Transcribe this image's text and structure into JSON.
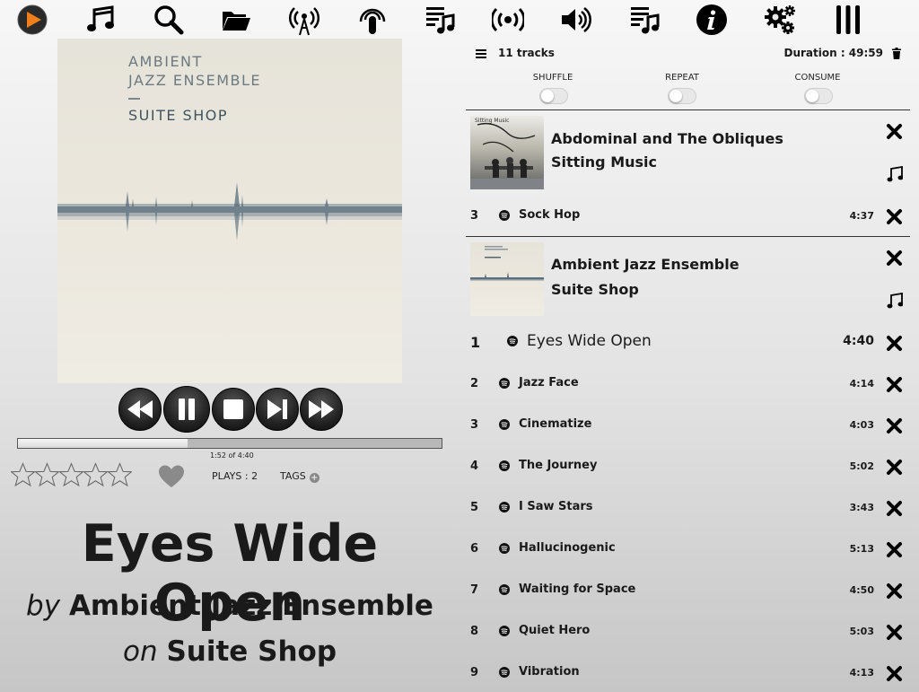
{
  "toolbar": {
    "icons": [
      "play-logo-icon",
      "music-library-icon",
      "search-icon",
      "folder-icon",
      "radio-tower-icon",
      "podcast-icon",
      "queue-music-icon",
      "stream-icon",
      "volume-icon",
      "playlist-icon",
      "info-icon",
      "settings-icon",
      "columns-icon"
    ]
  },
  "now_playing": {
    "cover": {
      "artist_text": "AMBIENT\nJAZZ ENSEMBLE",
      "album_text": "SUITE SHOP"
    },
    "progress": 0.4,
    "time_text": "1:52 of 4:40",
    "rating_stars": 0,
    "plays_text": "PLAYS : 2",
    "tags_label": "TAGS",
    "title": "Eyes Wide Open",
    "by_word": "by",
    "artist": "Ambient Jazz Ensemble",
    "on_word": "on",
    "album": "Suite Shop"
  },
  "playlist": {
    "count_text": "11 tracks",
    "duration_text": "Duration : 49:59",
    "toggles": [
      {
        "label": "SHUFFLE",
        "on": false
      },
      {
        "label": "REPEAT",
        "on": false
      },
      {
        "label": "CONSUME",
        "on": false
      }
    ],
    "groups": [
      {
        "album": "Abdominal and The Obliques",
        "artist": "Sitting Music",
        "cover_text": "Sitting Music",
        "tracks": [
          {
            "num": "3",
            "title": "Sock Hop",
            "duration": "4:37"
          }
        ]
      },
      {
        "album": "Ambient Jazz Ensemble",
        "artist": "Suite Shop",
        "tracks": [
          {
            "num": "1",
            "title": "Eyes Wide Open",
            "duration": "4:40"
          },
          {
            "num": "2",
            "title": "Jazz Face",
            "duration": "4:14"
          },
          {
            "num": "3",
            "title": "Cinematize",
            "duration": "4:03"
          },
          {
            "num": "4",
            "title": "The Journey",
            "duration": "5:02"
          },
          {
            "num": "5",
            "title": "I Saw Stars",
            "duration": "3:43"
          },
          {
            "num": "6",
            "title": "Hallucinogenic",
            "duration": "5:13"
          },
          {
            "num": "7",
            "title": "Waiting for Space",
            "duration": "4:50"
          },
          {
            "num": "8",
            "title": "Quiet Hero",
            "duration": "5:03"
          },
          {
            "num": "9",
            "title": "Vibration",
            "duration": "4:13"
          }
        ]
      }
    ]
  },
  "colors": {
    "accent": "#f07e1b",
    "text": "#1a1a1a",
    "icon": "#000000"
  }
}
